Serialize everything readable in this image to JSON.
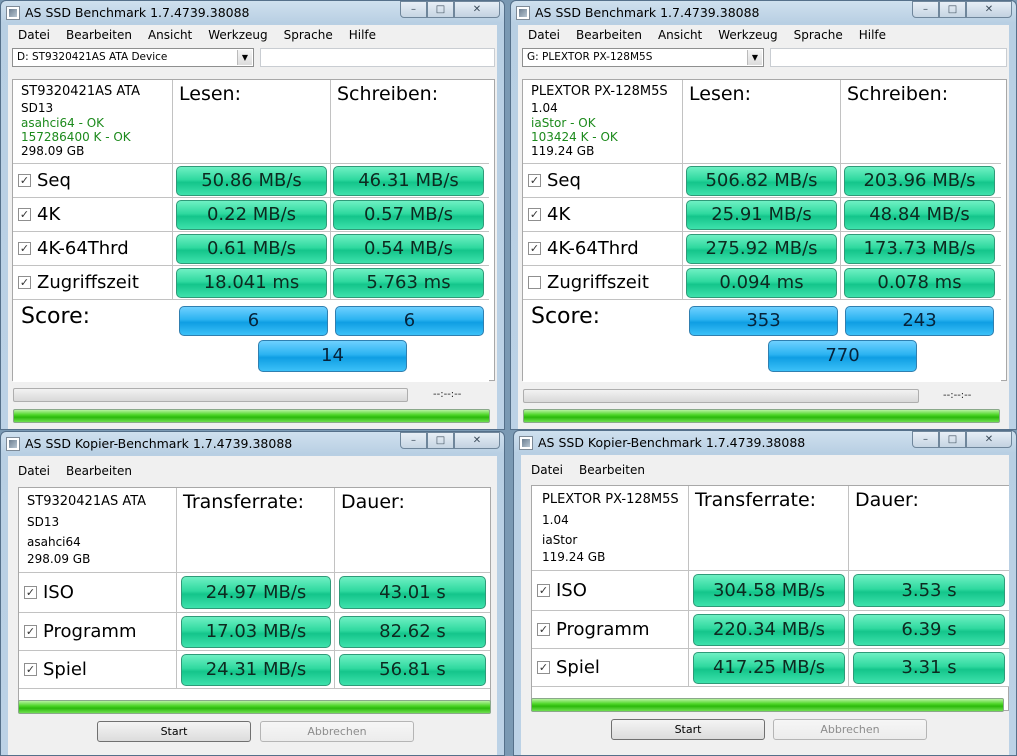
{
  "top_left": {
    "title": "AS SSD Benchmark 1.7.4739.38088",
    "menu": [
      "Datei",
      "Bearbeiten",
      "Ansicht",
      "Werkzeug",
      "Sprache",
      "Hilfe"
    ],
    "drive_select": "D: ST9320421AS ATA Device",
    "info": [
      "ST9320421AS ATA",
      "SD13",
      "asahci64 - OK",
      "157286400 K - OK",
      "298.09 GB"
    ],
    "col_read": "Lesen:",
    "col_write": "Schreiben:",
    "rows": [
      {
        "label": "Seq",
        "checked": true,
        "read": "50.86 MB/s",
        "write": "46.31 MB/s"
      },
      {
        "label": "4K",
        "checked": true,
        "read": "0.22 MB/s",
        "write": "0.57 MB/s"
      },
      {
        "label": "4K-64Thrd",
        "checked": true,
        "read": "0.61 MB/s",
        "write": "0.54 MB/s"
      },
      {
        "label": "Zugriffszeit",
        "checked": true,
        "read": "18.041 ms",
        "write": "5.763 ms"
      }
    ],
    "score_label": "Score:",
    "score_read": "6",
    "score_write": "6",
    "score_total": "14",
    "time": "--:--:--"
  },
  "top_right": {
    "title": "AS SSD Benchmark 1.7.4739.38088",
    "menu": [
      "Datei",
      "Bearbeiten",
      "Ansicht",
      "Werkzeug",
      "Sprache",
      "Hilfe"
    ],
    "drive_select": "G: PLEXTOR PX-128M5S",
    "info": [
      "PLEXTOR PX-128M5S",
      "1.04",
      "iaStor - OK",
      "103424 K - OK",
      "119.24 GB"
    ],
    "col_read": "Lesen:",
    "col_write": "Schreiben:",
    "rows": [
      {
        "label": "Seq",
        "checked": true,
        "read": "506.82 MB/s",
        "write": "203.96 MB/s"
      },
      {
        "label": "4K",
        "checked": true,
        "read": "25.91 MB/s",
        "write": "48.84 MB/s"
      },
      {
        "label": "4K-64Thrd",
        "checked": true,
        "read": "275.92 MB/s",
        "write": "173.73 MB/s"
      },
      {
        "label": "Zugriffszeit",
        "checked": false,
        "read": "0.094 ms",
        "write": "0.078 ms"
      }
    ],
    "score_label": "Score:",
    "score_read": "353",
    "score_write": "243",
    "score_total": "770",
    "time": "--:--:--"
  },
  "bottom_left": {
    "title": "AS SSD Kopier-Benchmark 1.7.4739.38088",
    "menu": [
      "Datei",
      "Bearbeiten"
    ],
    "info": [
      "ST9320421AS ATA",
      "SD13",
      "asahci64",
      "298.09 GB"
    ],
    "col_rate": "Transferrate:",
    "col_time": "Dauer:",
    "rows": [
      {
        "label": "ISO",
        "checked": true,
        "rate": "24.97 MB/s",
        "time": "43.01 s"
      },
      {
        "label": "Programm",
        "checked": true,
        "rate": "17.03 MB/s",
        "time": "82.62 s"
      },
      {
        "label": "Spiel",
        "checked": true,
        "rate": "24.31 MB/s",
        "time": "56.81 s"
      }
    ],
    "start": "Start",
    "cancel": "Abbrechen"
  },
  "bottom_right": {
    "title": "AS SSD Kopier-Benchmark 1.7.4739.38088",
    "menu": [
      "Datei",
      "Bearbeiten"
    ],
    "info": [
      "PLEXTOR PX-128M5S",
      "1.04",
      "iaStor",
      "119.24 GB"
    ],
    "col_rate": "Transferrate:",
    "col_time": "Dauer:",
    "rows": [
      {
        "label": "ISO",
        "checked": true,
        "rate": "304.58 MB/s",
        "time": "3.53 s"
      },
      {
        "label": "Programm",
        "checked": true,
        "rate": "220.34 MB/s",
        "time": "6.39 s"
      },
      {
        "label": "Spiel",
        "checked": true,
        "rate": "417.25 MB/s",
        "time": "3.31 s"
      }
    ],
    "start": "Start",
    "cancel": "Abbrechen"
  },
  "caption_buttons": {
    "minimize": "–",
    "maximize": "□",
    "close": "✕"
  },
  "check_mark": "✓"
}
